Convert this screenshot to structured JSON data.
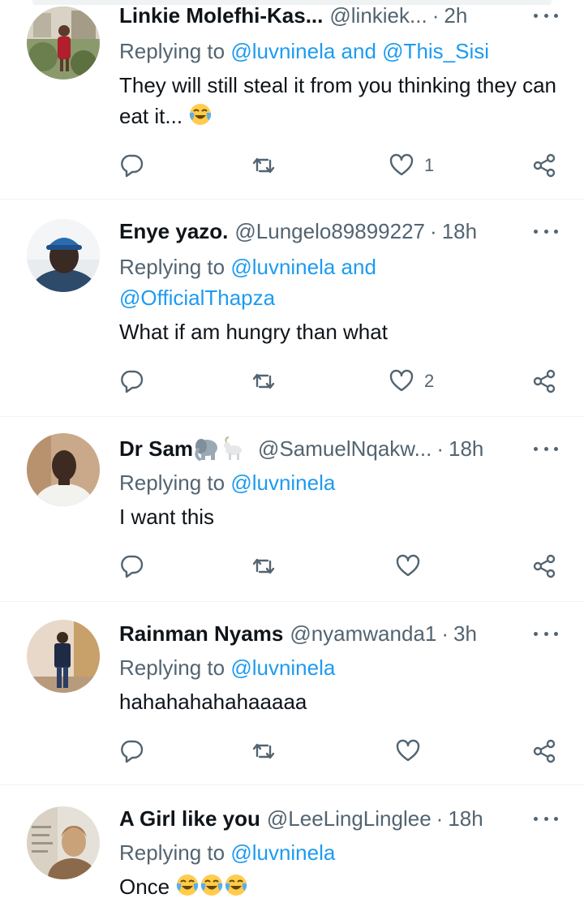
{
  "tweets": [
    {
      "name": "Linkie Molefhi-Kas...",
      "handle": "@linkiek...",
      "separator": "·",
      "time": "2h",
      "replying_prefix": "Replying to",
      "mentions_line1": "@luvninela and @This_Sisi",
      "mentions_line2": "",
      "text": "They will still steal it from you thinking they can eat it...",
      "text_emojis": [
        "face-with-tears-of-joy"
      ],
      "like_count": "1",
      "avatar_colors": [
        "#6b7f4e",
        "#d8c7b5",
        "#b01f2b"
      ]
    },
    {
      "name": "Enye yazo.",
      "handle": "@Lungelo89899227",
      "separator": "·",
      "time": "18h",
      "replying_prefix": "Replying to",
      "mentions_line1": "@luvninela and",
      "mentions_line2": "@OfficialThapza",
      "text": "What if am hungry than what",
      "text_emojis": [],
      "like_count": "2",
      "avatar_colors": [
        "#e9ecef",
        "#3a2a24",
        "#2b6cb0"
      ]
    },
    {
      "name": "Dr Sam",
      "name_emojis": [
        "elephant",
        "goat"
      ],
      "handle": "@SamuelNqakw...",
      "separator": "·",
      "time": "18h",
      "replying_prefix": "Replying to",
      "mentions_line1": "@luvninela",
      "mentions_line2": "",
      "text": "I want this",
      "text_emojis": [],
      "like_count": "",
      "avatar_colors": [
        "#c9a98a",
        "#3d2b22",
        "#f2f2ee"
      ]
    },
    {
      "name": "Rainman Nyams",
      "handle": "@nyamwanda1",
      "separator": "·",
      "time": "3h",
      "replying_prefix": "Replying to",
      "mentions_line1": "@luvninela",
      "mentions_line2": "",
      "text": "hahahahahahaaaaa",
      "text_emojis": [],
      "like_count": "",
      "avatar_colors": [
        "#e7d8c9",
        "#1f2a44",
        "#c8a06a"
      ]
    },
    {
      "name": "A Girl like you",
      "handle": "@LeeLingLinglee",
      "separator": "·",
      "time": "18h",
      "replying_prefix": "Replying to",
      "mentions_line1": "@luvninela",
      "mentions_line2": "",
      "text": "Once",
      "text_emojis": [
        "face-with-tears-of-joy",
        "face-with-tears-of-joy",
        "face-with-tears-of-joy"
      ],
      "like_count": "",
      "avatar_colors": [
        "#e6e1d8",
        "#c9a27a",
        "#8a6a4a"
      ]
    }
  ],
  "icons": {
    "reply": "reply-icon",
    "retweet": "retweet-icon",
    "like": "heart-icon",
    "share": "share-icon",
    "more": "more-icon"
  },
  "colors": {
    "text": "#0f1419",
    "secondary": "#536471",
    "mention": "#1d9bf0",
    "divider": "#eff3f4"
  }
}
